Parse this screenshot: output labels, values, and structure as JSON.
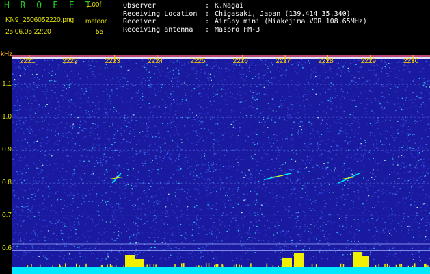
{
  "header": {
    "app_title": "H R O F F T",
    "version": "1.00f",
    "filename": "KN9_2506052220.png",
    "meteor_label": "meteor",
    "datetime": "25.06.05 22:20",
    "meteor_count": "55"
  },
  "station_info": [
    {
      "label": "Observer",
      "value": "K.Nagai"
    },
    {
      "label": "Receiving Location",
      "value": "Chigasaki, Japan (139.414 35.340)"
    },
    {
      "label": "Receiver",
      "value": "AirSpy mini (Miakejima VOR 108.65MHz)"
    },
    {
      "label": "Receiving antenna",
      "value": "Maspro FM-3"
    }
  ],
  "separator": ":",
  "axes": {
    "y_unit": "kHz",
    "y_ticks": [
      "1.1",
      "1.0",
      "0.9",
      "0.8",
      "0.7",
      "0.6"
    ],
    "y_values": [
      1.1,
      1.0,
      0.9,
      0.8,
      0.7,
      0.6
    ],
    "y_range": [
      0.565,
      1.19
    ],
    "x_ticks": [
      "2221",
      "2222",
      "2223",
      "2224",
      "2225",
      "2226",
      "2227",
      "2228",
      "2229",
      "2230"
    ],
    "x_range_minutes": [
      2220.6,
      2230.4
    ]
  },
  "colors": {
    "background_noise": "#1a1aa0",
    "trace_cyan": "#00e0ff",
    "trace_yellow": "#f0f000",
    "trace_red": "#ff3030"
  },
  "meteor_traces": [
    {
      "t_start": 2222.95,
      "t_end": 2223.15,
      "f_start": 0.8,
      "f_end": 0.83
    },
    {
      "t_start": 2226.5,
      "t_end": 2227.15,
      "f_start": 0.81,
      "f_end": 0.83
    },
    {
      "t_start": 2228.25,
      "t_end": 2228.75,
      "f_start": 0.8,
      "f_end": 0.83
    }
  ]
}
